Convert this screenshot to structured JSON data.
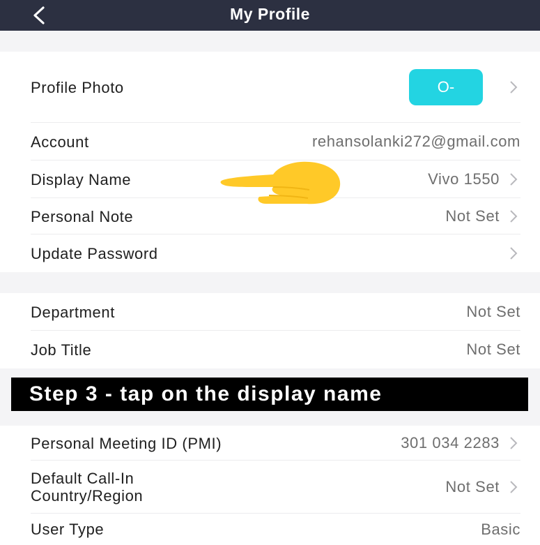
{
  "header": {
    "title": "My Profile",
    "back_icon": "chevron-left-icon"
  },
  "profile_photo": {
    "label": "Profile Photo",
    "avatar_text": "O-",
    "avatar_color": "#23d4e2"
  },
  "account": {
    "label": "Account",
    "value": "rehansolanki272@gmail.com"
  },
  "display_name": {
    "label": "Display Name",
    "value": "Vivo 1550"
  },
  "personal_note": {
    "label": "Personal Note",
    "value": "Not Set"
  },
  "update_password": {
    "label": "Update Password"
  },
  "department": {
    "label": "Department",
    "value": "Not Set"
  },
  "job_title": {
    "label": "Job Title",
    "value": "Not Set"
  },
  "instruction_banner": {
    "text": "Step 3 - tap on the display name"
  },
  "pmi": {
    "label": "Personal Meeting ID (PMI)",
    "value": "301 034 2283"
  },
  "call_in": {
    "label_line1": "Default Call-In",
    "label_line2": "Country/Region",
    "value": "Not Set"
  },
  "user_type": {
    "label": "User Type",
    "value": "Basic"
  },
  "colors": {
    "header_bg": "#2c3041",
    "accent": "#23d4e2",
    "pointer": "#ffc928",
    "section_gap": "#f4f4f6"
  }
}
